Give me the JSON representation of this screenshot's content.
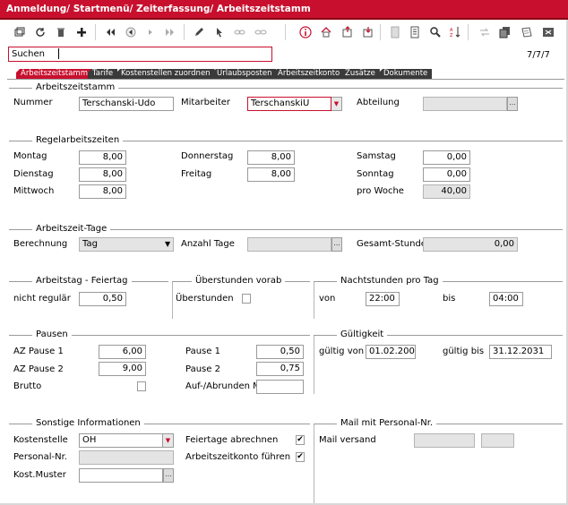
{
  "window": {
    "title": "Anmeldung/ Startmenü/ Zeiterfassung/ Arbeitszeitstamm"
  },
  "toolbar": {
    "icons": [
      "restore-icon",
      "refresh-icon",
      "delete-icon",
      "add-icon",
      "first-record-icon",
      "previous-record-icon",
      "next-record-icon",
      "last-record-icon",
      "edit-icon",
      "pointer-icon",
      "link-icon",
      "unlink-icon",
      "info-icon",
      "home-icon",
      "export-icon",
      "import-icon",
      "report-icon",
      "list-icon",
      "search-icon",
      "sort-icon",
      "filter-icon",
      "copy-icon",
      "note-icon",
      "close-icon"
    ]
  },
  "search": {
    "label": "Suchen",
    "record_counter": "7/7/7"
  },
  "tabs": [
    {
      "label": "Arbeitszeitstamm",
      "active": true
    },
    {
      "label": "Tarife",
      "active": false
    },
    {
      "label": "Kostenstellen zuordnen",
      "active": false
    },
    {
      "label": "Urlaubsposten",
      "active": false
    },
    {
      "label": "Arbeitszeitkonto",
      "active": false
    },
    {
      "label": "Zusätze",
      "active": false
    },
    {
      "label": "Dokumente",
      "active": false
    }
  ],
  "arbeitszeitstamm": {
    "title": "Arbeitszeitstamm",
    "nummer_label": "Nummer",
    "nummer_value": "Terschanski-Udo",
    "mitarbeiter_label": "Mitarbeiter",
    "mitarbeiter_value": "TerschanskiU",
    "abteilung_label": "Abteilung",
    "abteilung_value": ""
  },
  "regelarbeitszeiten": {
    "title": "Regelarbeitszeiten",
    "montag_label": "Montag",
    "montag_value": "8,00",
    "dienstag_label": "Dienstag",
    "dienstag_value": "8,00",
    "mittwoch_label": "Mittwoch",
    "mittwoch_value": "8,00",
    "donnerstag_label": "Donnerstag",
    "donnerstag_value": "8,00",
    "freitag_label": "Freitag",
    "freitag_value": "8,00",
    "samstag_label": "Samstag",
    "samstag_value": "0,00",
    "sonntag_label": "Sonntag",
    "sonntag_value": "0,00",
    "pro_woche_label": "pro Woche",
    "pro_woche_value": "40,00"
  },
  "arbeitszeit_tage": {
    "title": "Arbeitszeit-Tage",
    "berechnung_label": "Berechnung",
    "berechnung_value": "Tag",
    "anzahl_tage_label": "Anzahl Tage",
    "anzahl_tage_value": "",
    "gesamt_stunde_label": "Gesamt-Stunde",
    "gesamt_stunde_value": "0,00"
  },
  "arbeitstag_feiertag": {
    "title": "Arbeitstag - Feiertag",
    "nicht_regulaer_label": "nicht regulär",
    "nicht_regulaer_value": "0,50"
  },
  "ueberstunden_vorab": {
    "title": "Überstunden vorab",
    "ueberstunden_label": "Überstunden",
    "ueberstunden_checked": false
  },
  "nachtstunden": {
    "title": "Nachtstunden pro Tag",
    "von_label": "von",
    "von_value": "22:00",
    "bis_label": "bis",
    "bis_value": "04:00"
  },
  "pausen": {
    "title": "Pausen",
    "az_pause1_label": "AZ Pause 1",
    "az_pause1_value": "6,00",
    "az_pause2_label": "AZ Pause 2",
    "az_pause2_value": "9,00",
    "pause1_label": "Pause 1",
    "pause1_value": "0,50",
    "pause2_label": "Pause 2",
    "pause2_value": "0,75",
    "brutto_label": "Brutto",
    "brutto_checked": false,
    "aufabrunden_label": "Auf-/Abrunden M",
    "aufabrunden_value": ""
  },
  "gueltigkeit": {
    "title": "Gültigkeit",
    "von_label": "gültig von",
    "von_value": "01.02.2008",
    "bis_label": "gültig bis",
    "bis_value": "31.12.2031"
  },
  "sonstige": {
    "title": "Sonstige Informationen",
    "kostenstelle_label": "Kostenstelle",
    "kostenstelle_value": "OH",
    "personal_nr_label": "Personal-Nr.",
    "personal_nr_value": "",
    "kost_muster_label": "Kost.Muster",
    "kost_muster_value": "",
    "feiertage_label": "Feiertage abrechnen",
    "feiertage_checked": true,
    "az_konto_label": "Arbeitszeitkonto führen",
    "az_konto_checked": true
  },
  "mail": {
    "title": "Mail mit Personal-Nr.",
    "mail_versand_label": "Mail versand"
  },
  "glyphs": {
    "checked": "✔",
    "dropdown": "▼",
    "ellipsis": "..."
  }
}
